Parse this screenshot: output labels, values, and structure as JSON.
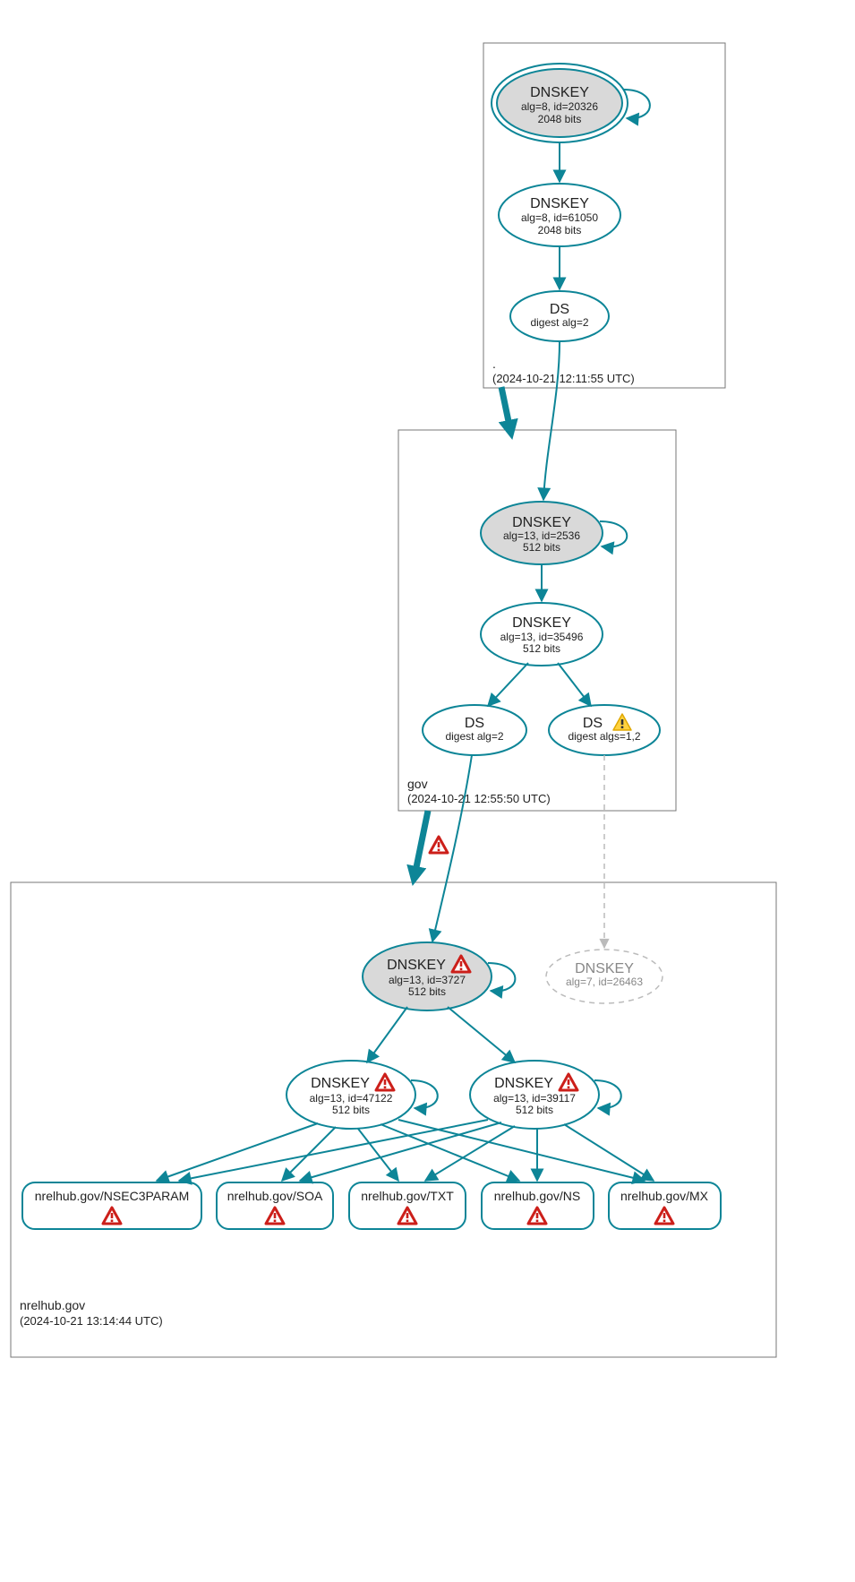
{
  "chart_data": {
    "type": "diagram",
    "zones": [
      {
        "name": ".",
        "timestamp": "(2024-10-21 12:11:55 UTC)"
      },
      {
        "name": "gov",
        "timestamp": "(2024-10-21 12:55:50 UTC)"
      },
      {
        "name": "nrelhub.gov",
        "timestamp": "(2024-10-21 13:14:44 UTC)"
      }
    ],
    "nodes": {
      "root_ksk": {
        "title": "DNSKEY",
        "l1": "alg=8, id=20326",
        "l2": "2048 bits"
      },
      "root_zsk": {
        "title": "DNSKEY",
        "l1": "alg=8, id=61050",
        "l2": "2048 bits"
      },
      "root_ds": {
        "title": "DS",
        "l1": "digest alg=2"
      },
      "gov_ksk": {
        "title": "DNSKEY",
        "l1": "alg=13, id=2536",
        "l2": "512 bits"
      },
      "gov_zsk": {
        "title": "DNSKEY",
        "l1": "alg=13, id=35496",
        "l2": "512 bits"
      },
      "gov_ds1": {
        "title": "DS",
        "l1": "digest alg=2"
      },
      "gov_ds2": {
        "title": "DS",
        "l1": "digest algs=1,2"
      },
      "nrel_ksk": {
        "title": "DNSKEY",
        "l1": "alg=13, id=3727",
        "l2": "512 bits"
      },
      "nrel_extra": {
        "title": "DNSKEY",
        "l1": "alg=7, id=26463"
      },
      "nrel_zsk1": {
        "title": "DNSKEY",
        "l1": "alg=13, id=47122",
        "l2": "512 bits"
      },
      "nrel_zsk2": {
        "title": "DNSKEY",
        "l1": "alg=13, id=39117",
        "l2": "512 bits"
      },
      "rr_nsec3": {
        "label": "nrelhub.gov/NSEC3PARAM"
      },
      "rr_soa": {
        "label": "nrelhub.gov/SOA"
      },
      "rr_txt": {
        "label": "nrelhub.gov/TXT"
      },
      "rr_ns": {
        "label": "nrelhub.gov/NS"
      },
      "rr_mx": {
        "label": "nrelhub.gov/MX"
      }
    }
  }
}
